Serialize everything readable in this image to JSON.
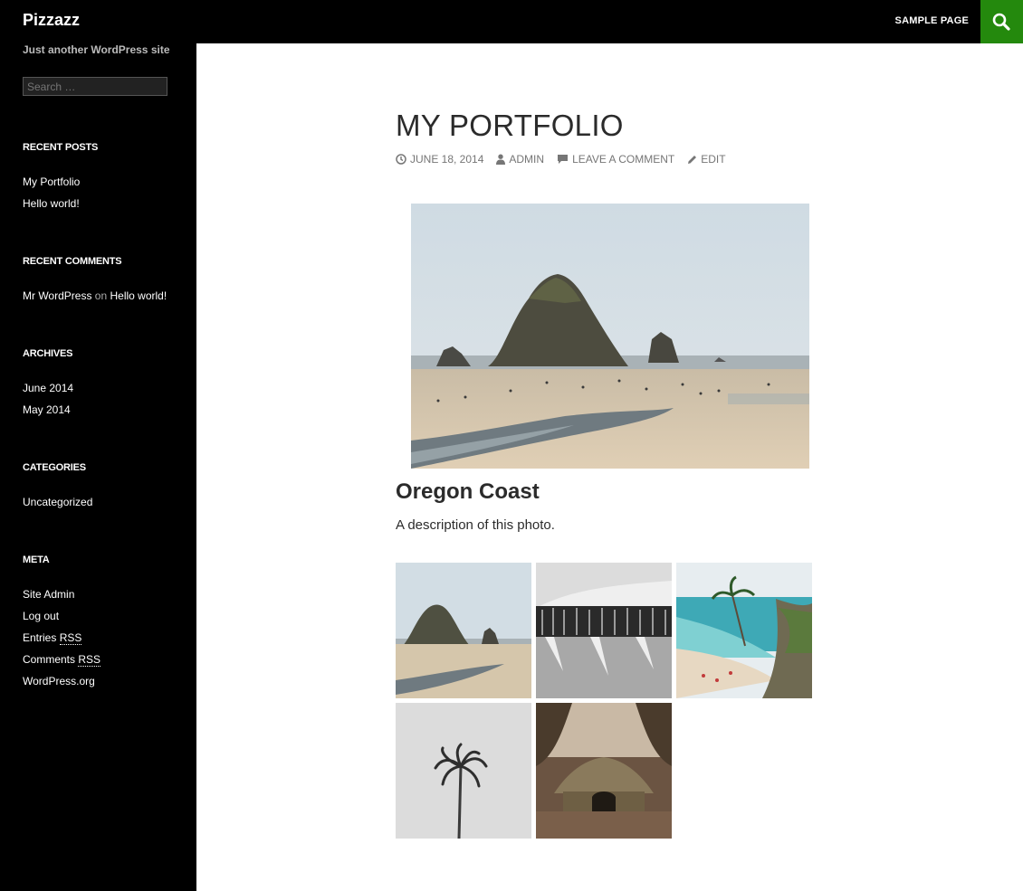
{
  "site": {
    "title": "Pizzazz",
    "tagline": "Just another WordPress site"
  },
  "nav": {
    "sample_page": "SAMPLE PAGE"
  },
  "colors": {
    "accent": "#24890d",
    "sidebar_bg": "#000000"
  },
  "search": {
    "placeholder": "Search …"
  },
  "widgets": {
    "recent_posts": {
      "title": "RECENT POSTS",
      "items": [
        "My Portfolio",
        "Hello world!"
      ]
    },
    "recent_comments": {
      "title": "RECENT COMMENTS",
      "author": "Mr WordPress",
      "on": "on",
      "post": "Hello world!"
    },
    "archives": {
      "title": "ARCHIVES",
      "items": [
        "June 2014",
        "May 2014"
      ]
    },
    "categories": {
      "title": "CATEGORIES",
      "items": [
        "Uncategorized"
      ]
    },
    "meta": {
      "title": "META",
      "site_admin": "Site Admin",
      "log_out": "Log out",
      "entries_prefix": "Entries",
      "comments_prefix": "Comments",
      "rss": "RSS",
      "wordpress_org": "WordPress.org"
    }
  },
  "post": {
    "title": "MY PORTFOLIO",
    "date": "JUNE 18, 2014",
    "author": "ADMIN",
    "comment": "LEAVE A COMMENT",
    "edit": "EDIT",
    "photo_title": "Oregon Coast",
    "photo_description": "A description of this photo."
  },
  "gallery": {
    "images": [
      "haystack-rock-thumbnail",
      "snowy-forest-thumbnail",
      "tropical-beach-thumbnail",
      "palm-tree-thumbnail",
      "hut-thumbnail"
    ]
  }
}
